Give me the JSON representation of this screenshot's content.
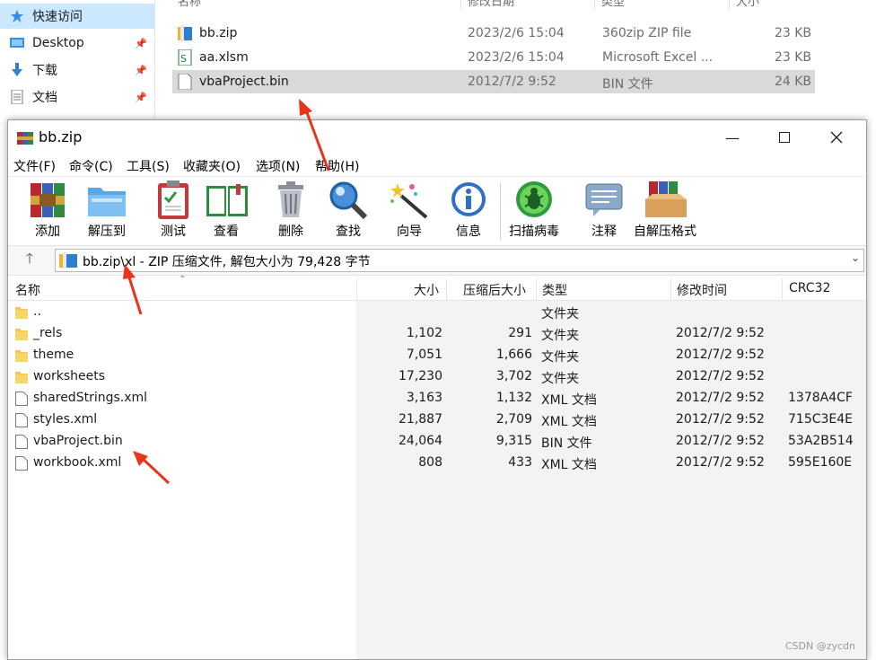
{
  "explorer": {
    "nav": [
      {
        "label": "快速访问",
        "icon": "star-icon"
      },
      {
        "label": "Desktop",
        "icon": "desktop-icon"
      },
      {
        "label": "下载",
        "icon": "download-icon"
      },
      {
        "label": "文档",
        "icon": "document-icon"
      }
    ],
    "columns": {
      "name": "名称",
      "date": "修改日期",
      "type": "类型",
      "size": "大小"
    },
    "files": [
      {
        "name": "bb.zip",
        "date": "2023/2/6 15:04",
        "type": "360zip ZIP file",
        "size": "23 KB",
        "icon": "zip-archive-icon"
      },
      {
        "name": "aa.xlsm",
        "date": "2023/2/6 15:04",
        "type": "Microsoft Excel ...",
        "size": "23 KB",
        "icon": "excel-file-icon"
      },
      {
        "name": "vbaProject.bin",
        "date": "2012/7/2 9:52",
        "type": "BIN 文件",
        "size": "24 KB",
        "icon": "file-icon",
        "selected": true
      }
    ]
  },
  "winrar": {
    "title": "bb.zip",
    "menu": [
      "文件(F)",
      "命令(C)",
      "工具(S)",
      "收藏夹(O)",
      "选项(N)",
      "帮助(H)"
    ],
    "toolbar": [
      {
        "label": "添加",
        "icon": "add-archive-icon"
      },
      {
        "label": "解压到",
        "icon": "extract-folder-icon"
      },
      {
        "label": "测试",
        "icon": "test-clipboard-icon"
      },
      {
        "label": "查看",
        "icon": "view-book-icon"
      },
      {
        "label": "删除",
        "icon": "trash-icon"
      },
      {
        "label": "查找",
        "icon": "magnifier-icon"
      },
      {
        "label": "向导",
        "icon": "wizard-wand-icon"
      },
      {
        "label": "信息",
        "icon": "info-icon"
      },
      {
        "label": "扫描病毒",
        "icon": "virus-scan-icon"
      },
      {
        "label": "注释",
        "icon": "comment-icon"
      },
      {
        "label": "自解压格式",
        "icon": "sfx-box-icon"
      }
    ],
    "address": "bb.zip\\xl - ZIP 压缩文件, 解包大小为 79,428 字节",
    "columns": {
      "name": "名称",
      "size": "大小",
      "packed": "压缩后大小",
      "type": "类型",
      "modified": "修改时间",
      "crc": "CRC32"
    },
    "rows": [
      {
        "name": "..",
        "size": "",
        "packed": "",
        "type": "文件夹",
        "modified": "",
        "crc": "",
        "kind": "folder"
      },
      {
        "name": "_rels",
        "size": "1,102",
        "packed": "291",
        "type": "文件夹",
        "modified": "2012/7/2 9:52",
        "crc": "",
        "kind": "folder"
      },
      {
        "name": "theme",
        "size": "7,051",
        "packed": "1,666",
        "type": "文件夹",
        "modified": "2012/7/2 9:52",
        "crc": "",
        "kind": "folder"
      },
      {
        "name": "worksheets",
        "size": "17,230",
        "packed": "3,702",
        "type": "文件夹",
        "modified": "2012/7/2 9:52",
        "crc": "",
        "kind": "folder"
      },
      {
        "name": "sharedStrings.xml",
        "size": "3,163",
        "packed": "1,132",
        "type": "XML 文档",
        "modified": "2012/7/2 9:52",
        "crc": "1378A4CF",
        "kind": "file"
      },
      {
        "name": "styles.xml",
        "size": "21,887",
        "packed": "2,709",
        "type": "XML 文档",
        "modified": "2012/7/2 9:52",
        "crc": "715C3E4E",
        "kind": "file"
      },
      {
        "name": "vbaProject.bin",
        "size": "24,064",
        "packed": "9,315",
        "type": "BIN 文件",
        "modified": "2012/7/2 9:52",
        "crc": "53A2B514",
        "kind": "file"
      },
      {
        "name": "workbook.xml",
        "size": "808",
        "packed": "433",
        "type": "XML 文档",
        "modified": "2012/7/2 9:52",
        "crc": "595E160E",
        "kind": "file"
      }
    ]
  },
  "watermark": "CSDN @zycdn",
  "colors": {
    "selection": "#cce8ff",
    "file_selected": "#d9d9d9",
    "arrow": "#e8341c",
    "folder": "#f5c542"
  }
}
